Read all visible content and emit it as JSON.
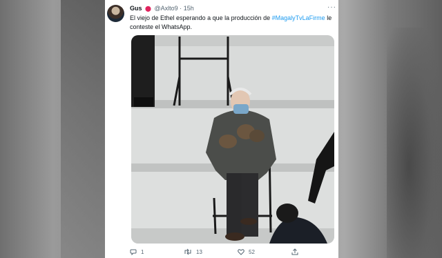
{
  "tweet": {
    "display_name": "Gus",
    "flag_icon": "pokeball-icon",
    "handle": "@Axlto9",
    "separator": "·",
    "time": "15h",
    "text_before": "El viejo de Ethel esperando a que la producción de ",
    "hashtag": "#MagalyTvLaFirme",
    "text_after": " le conteste el WhatsApp.",
    "more_label": "···"
  },
  "actions": {
    "reply_count": "1",
    "retweet_count": "13",
    "like_count": "52"
  },
  "colors": {
    "accent": "#1d9bf0",
    "text": "#0f1419",
    "secondary": "#536471"
  }
}
